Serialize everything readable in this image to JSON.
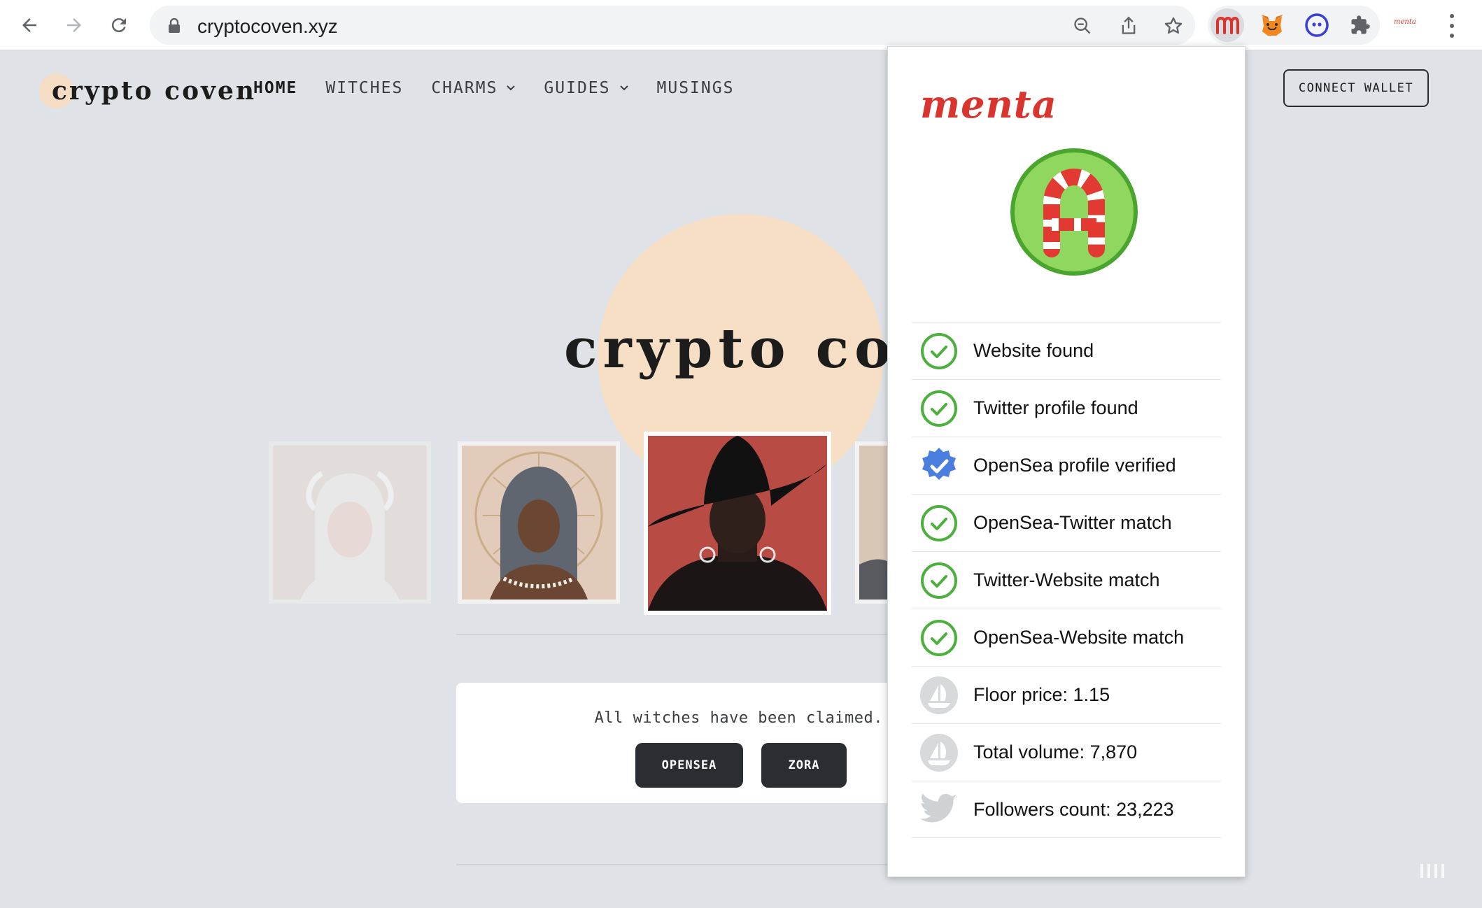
{
  "browser": {
    "url": "cryptocoven.xyz",
    "extension_mini_label": "menta"
  },
  "site": {
    "logo_text": "crypto coven",
    "nav": [
      {
        "label": "HOME"
      },
      {
        "label": "WITCHES"
      },
      {
        "label": "CHARMS"
      },
      {
        "label": "GUIDES"
      },
      {
        "label": "MUSINGS"
      }
    ],
    "connect_label": "CONNECT WALLET",
    "hero_title": "crypto coven",
    "claim_text": "All witches have been claimed.",
    "opensea_label": "OPENSEA",
    "zora_label": "ZORA"
  },
  "popup": {
    "brand": "menta",
    "checks": [
      {
        "label": "Website found",
        "icon": "check-circle-icon"
      },
      {
        "label": "Twitter profile found",
        "icon": "check-circle-icon"
      },
      {
        "label": "OpenSea profile verified",
        "icon": "verified-badge-icon"
      },
      {
        "label": "OpenSea-Twitter match",
        "icon": "check-circle-icon"
      },
      {
        "label": "Twitter-Website match",
        "icon": "check-circle-icon"
      },
      {
        "label": "OpenSea-Website match",
        "icon": "check-circle-icon"
      },
      {
        "label": "Floor price: 1.15",
        "icon": "opensea-icon"
      },
      {
        "label": "Total volume: 7,870",
        "icon": "opensea-icon"
      },
      {
        "label": "Followers count: 23,223",
        "icon": "twitter-icon"
      }
    ]
  },
  "colors": {
    "accent_green": "#4caf3e",
    "brand_red": "#d9352e",
    "verified_blue": "#4a7fe0"
  }
}
